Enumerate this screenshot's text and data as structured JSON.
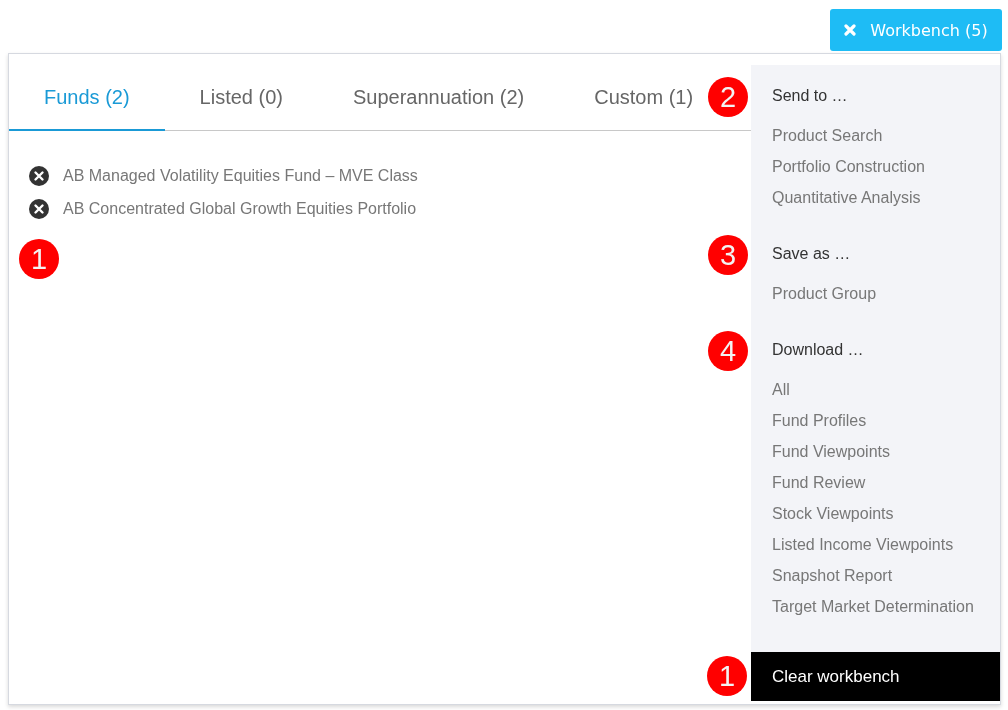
{
  "workbench_button": {
    "label": "Workbench (5)"
  },
  "tabs": [
    {
      "label": "Funds (2)",
      "selected": true
    },
    {
      "label": "Listed (0)",
      "selected": false
    },
    {
      "label": "Superannuation (2)",
      "selected": false
    },
    {
      "label": "Custom (1)",
      "selected": false
    }
  ],
  "funds": {
    "marker": "1",
    "items": [
      "AB Managed Volatility Equities Fund – MVE Class",
      "AB Concentrated Global Growth Equities Portfolio"
    ]
  },
  "menu": {
    "sections": [
      {
        "heading": "Send to …",
        "marker": "2",
        "items": [
          "Product Search",
          "Portfolio Construction",
          "Quantitative Analysis"
        ]
      },
      {
        "heading": "Save as …",
        "marker": "3",
        "items": [
          "Product Group"
        ]
      },
      {
        "heading": "Download …",
        "marker": "4",
        "items": [
          "All",
          "Fund Profiles",
          "Fund Viewpoints",
          "Fund Review",
          "Stock Viewpoints",
          "Listed Income Viewpoints",
          "Snapshot Report",
          "Target Market Determination"
        ]
      }
    ],
    "clear": {
      "label": "Clear workbench",
      "marker": "1"
    }
  }
}
